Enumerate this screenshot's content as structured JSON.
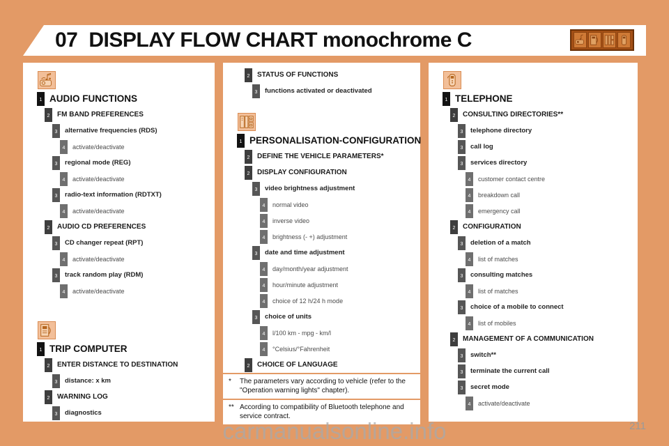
{
  "header": {
    "chapter_number": "07",
    "title": "DISPLAY FLOW CHART monochrome C",
    "icon_strip": [
      "audio-mini-icon",
      "trip-computer-mini-icon",
      "personalisation-mini-icon",
      "telephone-mini-icon"
    ]
  },
  "colors": {
    "page_background": "#e39a66",
    "panel_background": "#ffffff",
    "icon_fill": "#f2bf99",
    "icon_border": "#d98b52",
    "level1_badge": "#131313",
    "level2_badge": "#3e3e3e",
    "level3_badge": "#565656",
    "level4_badge": "#6f6f6f",
    "header_icon_strip": "#a34f15"
  },
  "columns": {
    "left": {
      "sections": [
        {
          "icon": "audio-icon",
          "rows": [
            {
              "level": 1,
              "label": "AUDIO FUNCTIONS"
            },
            {
              "level": 2,
              "label": "FM BAND PREFERENCES"
            },
            {
              "level": 3,
              "label": "alternative frequencies (RDS)"
            },
            {
              "level": 4,
              "label": "activate/deactivate"
            },
            {
              "level": 3,
              "label": "regional mode (REG)"
            },
            {
              "level": 4,
              "label": "activate/deactivate"
            },
            {
              "level": 3,
              "label": "radio-text information (RDTXT)"
            },
            {
              "level": 4,
              "label": "activate/deactivate"
            },
            {
              "level": 2,
              "label": "AUDIO CD PREFERENCES"
            },
            {
              "level": 3,
              "label": "CD changer repeat (RPT)"
            },
            {
              "level": 4,
              "label": "activate/deactivate"
            },
            {
              "level": 3,
              "label": "track random play (RDM)"
            },
            {
              "level": 4,
              "label": "activate/deactivate"
            }
          ]
        },
        {
          "icon": "trip-computer-icon",
          "rows": [
            {
              "level": 1,
              "label": "TRIP COMPUTER"
            },
            {
              "level": 2,
              "label": "ENTER DISTANCE TO DESTINATION"
            },
            {
              "level": 3,
              "label": "distance: x km"
            },
            {
              "level": 2,
              "label": "WARNING LOG"
            },
            {
              "level": 3,
              "label": "diagnostics"
            }
          ]
        }
      ]
    },
    "middle": {
      "sections": [
        {
          "icon": null,
          "rows": [
            {
              "level": 2,
              "label": "STATUS OF FUNCTIONS"
            },
            {
              "level": 3,
              "label": "functions activated or deactivated"
            }
          ]
        },
        {
          "icon": "personalisation-icon",
          "rows": [
            {
              "level": 1,
              "label": "PERSONALISATION-CONFIGURATION"
            },
            {
              "level": 2,
              "label": "DEFINE THE VEHICLE PARAMETERS*"
            },
            {
              "level": 2,
              "label": "DISPLAY CONFIGURATION"
            },
            {
              "level": 3,
              "label": "video brightness adjustment"
            },
            {
              "level": 4,
              "label": "normal video"
            },
            {
              "level": 4,
              "label": "inverse video"
            },
            {
              "level": 4,
              "label": "brightness (- +) adjustment"
            },
            {
              "level": 3,
              "label": "date and time adjustment"
            },
            {
              "level": 4,
              "label": "day/month/year adjustment"
            },
            {
              "level": 4,
              "label": "hour/minute adjustment"
            },
            {
              "level": 4,
              "label": "choice of 12 h/24 h mode"
            },
            {
              "level": 3,
              "label": "choice of units"
            },
            {
              "level": 4,
              "label": "l/100 km - mpg - km/l"
            },
            {
              "level": 4,
              "label": "°Celsius/°Fahrenheit"
            },
            {
              "level": 2,
              "label": "CHOICE OF LANGUAGE"
            }
          ]
        }
      ],
      "footnotes": [
        {
          "mark": "*",
          "text": "The parameters vary according to vehicle (refer to the \"Operation warning lights\" chapter)."
        },
        {
          "mark": "**",
          "text": "According to compatibility of Bluetooth telephone and service contract."
        }
      ]
    },
    "right": {
      "sections": [
        {
          "icon": "telephone-icon",
          "rows": [
            {
              "level": 1,
              "label": "TELEPHONE"
            },
            {
              "level": 2,
              "label": "CONSULTING DIRECTORIES**"
            },
            {
              "level": 3,
              "label": "telephone directory"
            },
            {
              "level": 3,
              "label": "call log"
            },
            {
              "level": 3,
              "label": "services directory"
            },
            {
              "level": 4,
              "label": "customer contact centre"
            },
            {
              "level": 4,
              "label": "breakdown call"
            },
            {
              "level": 4,
              "label": "emergency call"
            },
            {
              "level": 2,
              "label": "CONFIGURATION"
            },
            {
              "level": 3,
              "label": "deletion of a match"
            },
            {
              "level": 4,
              "label": "list of matches"
            },
            {
              "level": 3,
              "label": "consulting matches"
            },
            {
              "level": 4,
              "label": "list of matches"
            },
            {
              "level": 3,
              "label": "choice of a mobile to connect"
            },
            {
              "level": 4,
              "label": "list of mobiles"
            },
            {
              "level": 2,
              "label": "MANAGEMENT OF A COMMUNICATION"
            },
            {
              "level": 3,
              "label": "switch**"
            },
            {
              "level": 3,
              "label": "terminate the current call"
            },
            {
              "level": 3,
              "label": "secret mode"
            },
            {
              "level": 4,
              "label": "activate/deactivate"
            }
          ]
        }
      ]
    }
  },
  "page_number": "211",
  "watermark": "carmanualsonline.info"
}
